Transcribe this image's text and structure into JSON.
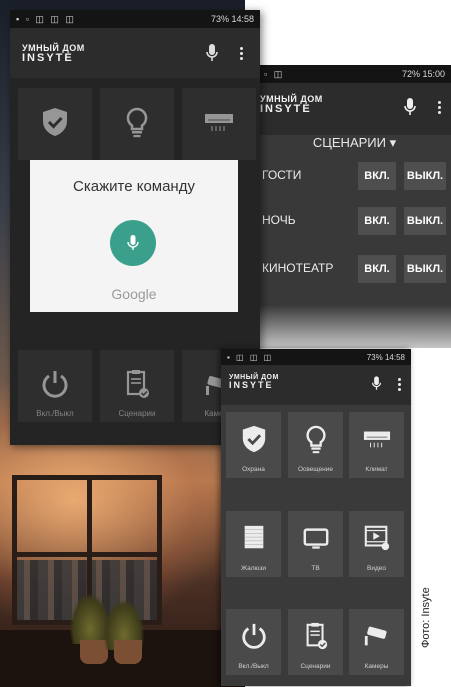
{
  "background": {
    "description_icon": "room-window-photo"
  },
  "screen_back_left": {
    "status": {
      "right_text": "73% 14:58"
    },
    "logo": {
      "line1": "УМНЫЙ ДОМ",
      "line2": "INSYTE"
    },
    "tiles": [
      {
        "icon": "shield-check-icon",
        "label": ""
      },
      {
        "icon": "lightbulb-icon",
        "label": ""
      },
      {
        "icon": "air-conditioner-icon",
        "label": ""
      },
      {
        "icon": "power-icon",
        "label": "Вкл./Выкл"
      },
      {
        "icon": "clipboard-check-icon",
        "label": "Сценарии"
      },
      {
        "icon": "camera-icon",
        "label": "Камеры"
      }
    ],
    "voice_dialog": {
      "title": "Скажите команду",
      "brand": "Google"
    }
  },
  "screen_back_right": {
    "status": {
      "right_text": "72% 15:00"
    },
    "logo": {
      "line1": "УМНЫЙ ДОМ",
      "line2": "INSYTE"
    },
    "section_title": "СЦЕНАРИИ ▾",
    "scenarios": [
      {
        "name": "ГОСТИ",
        "on": "ВКЛ.",
        "off": "ВЫКЛ."
      },
      {
        "name": "НОЧЬ",
        "on": "ВКЛ.",
        "off": "ВЫКЛ."
      },
      {
        "name": "КИНОТЕАТР",
        "on": "ВКЛ.",
        "off": "ВЫКЛ."
      }
    ]
  },
  "screen_front": {
    "status": {
      "right_text": "73% 14:58"
    },
    "logo": {
      "line1": "УМНЫЙ ДОМ",
      "line2": "INSYTE"
    },
    "tiles": [
      {
        "icon": "shield-check-icon",
        "label": "Охрана"
      },
      {
        "icon": "lightbulb-icon",
        "label": "Освещение"
      },
      {
        "icon": "air-conditioner-icon",
        "label": "Климат"
      },
      {
        "icon": "blinds-icon",
        "label": "Жалюзи"
      },
      {
        "icon": "tv-icon",
        "label": "ТВ"
      },
      {
        "icon": "video-icon",
        "label": "Видео"
      },
      {
        "icon": "power-icon",
        "label": "Вкл./Выкл"
      },
      {
        "icon": "clipboard-check-icon",
        "label": "Сценарии"
      },
      {
        "icon": "camera-icon",
        "label": "Камеры"
      }
    ]
  },
  "caption": "Фото: Insyte"
}
